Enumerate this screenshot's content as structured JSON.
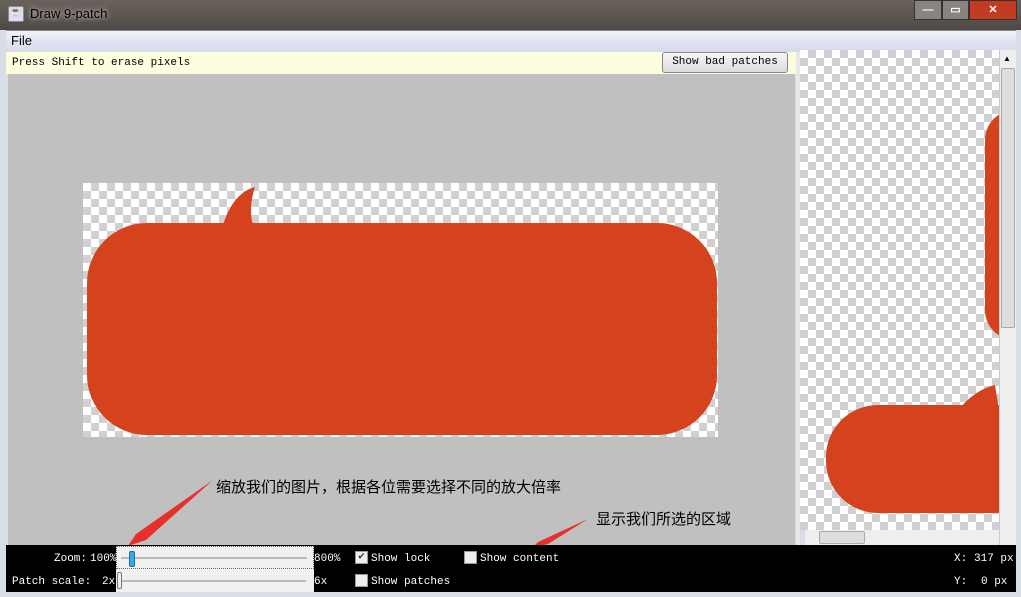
{
  "window": {
    "title": "Draw 9-patch"
  },
  "menu": {
    "file": "File"
  },
  "hint": "Press Shift to erase pixels",
  "show_bad_patches": "Show bad patches",
  "controls": {
    "zoom_label": "Zoom:",
    "zoom_min": "100%",
    "zoom_max": "800%",
    "zoom_value_percent": 100,
    "patch_label": "Patch scale:",
    "patch_min": "2x",
    "patch_max": "6x",
    "patch_value": 2,
    "show_lock": "Show lock",
    "show_lock_checked": true,
    "show_patches": "Show patches",
    "show_patches_checked": false,
    "show_content": "Show content",
    "show_content_checked": false,
    "x_label": "X:",
    "x_value": "317 px",
    "y_label": "Y:",
    "y_value": "0 px"
  },
  "annotations": {
    "zoom_note": "缩放我们的图片，根据各位需要选择不同的放大倍率",
    "content_note": "显示我们所选的区域"
  },
  "colors": {
    "bubble": "#d4421e",
    "arrow": "#e8302a"
  }
}
